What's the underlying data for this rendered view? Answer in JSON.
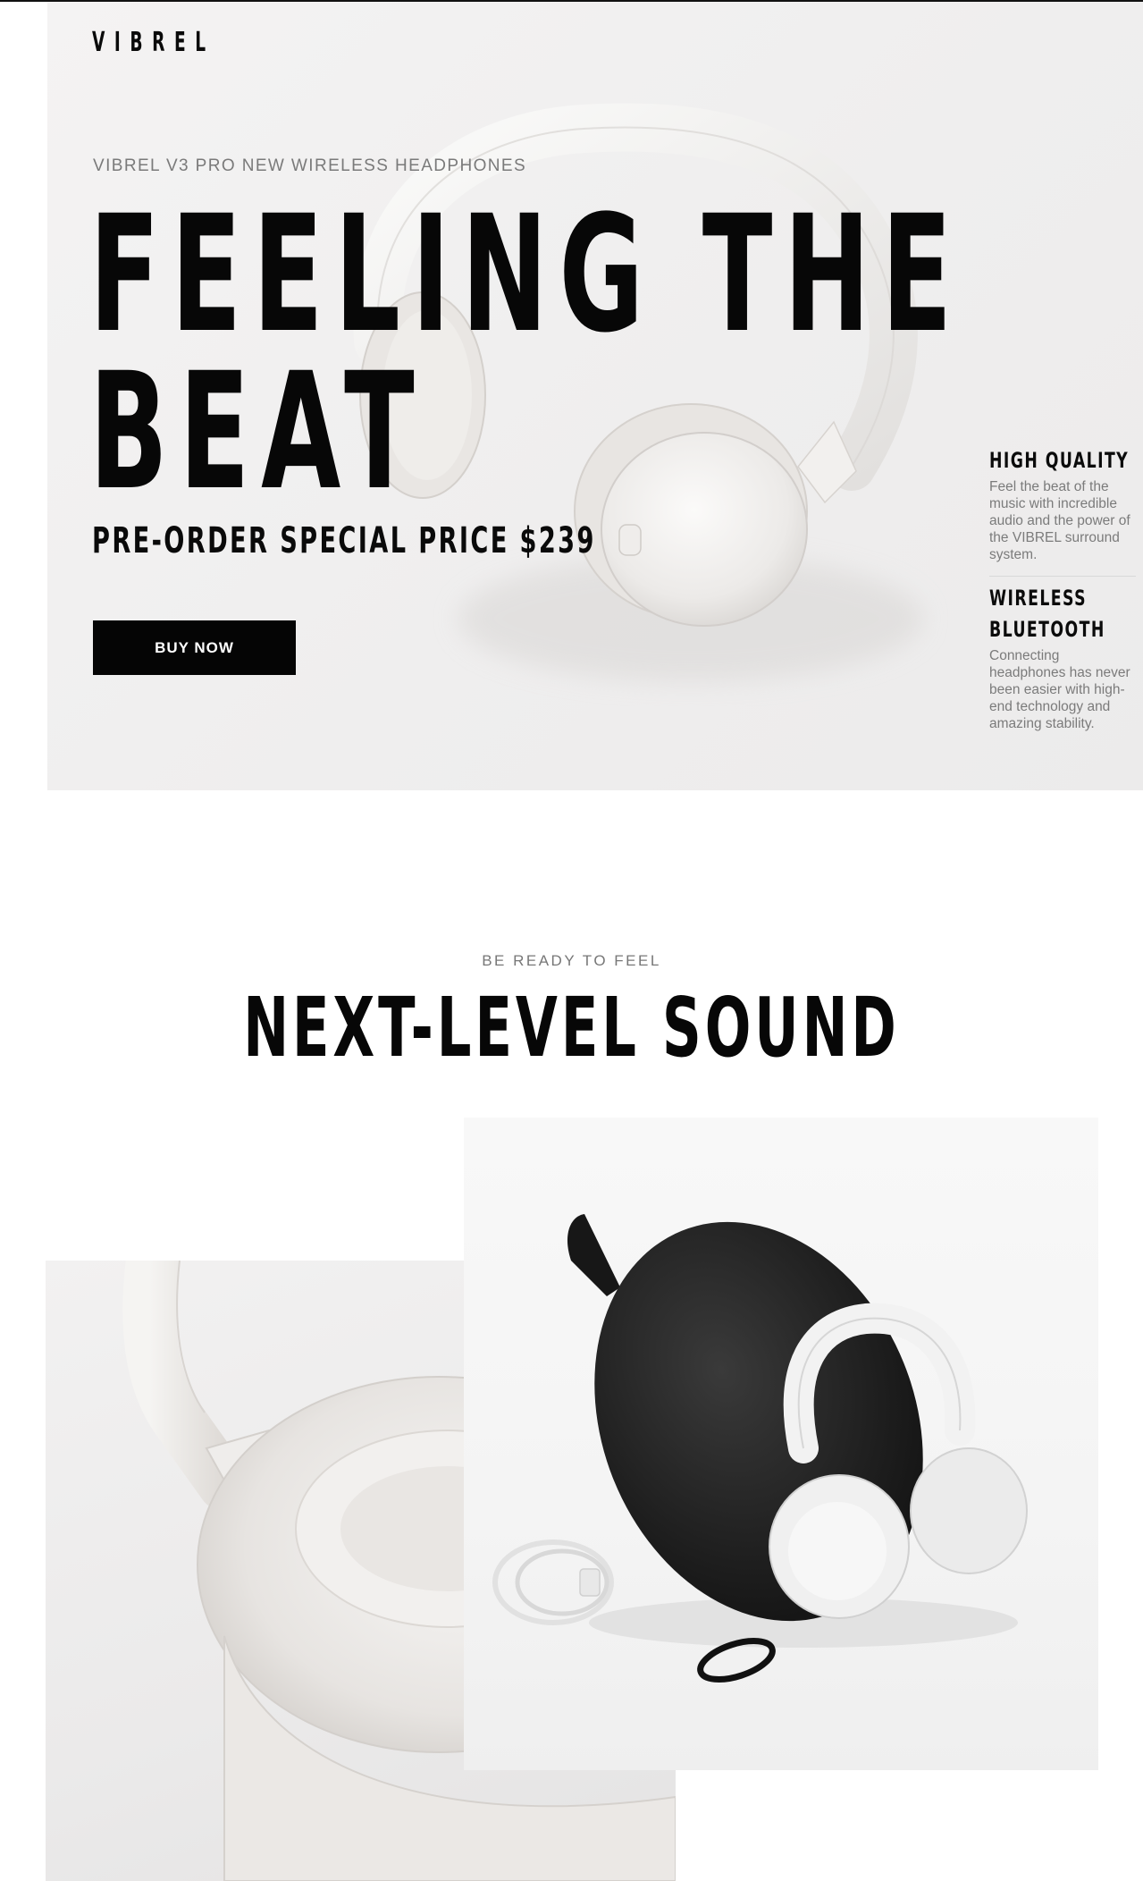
{
  "brand": {
    "logo": "VIBREL"
  },
  "hero": {
    "eyebrow": "VIBREL V3 PRO NEW WIRELESS HEADPHONES",
    "headline_line1": "FEELING THE",
    "headline_line2": "BEAT",
    "price": "PRE-ORDER SPECIAL PRICE $239",
    "buy_label": "BUY NOW"
  },
  "features": [
    {
      "title_lines": [
        "HIGH QUALITY"
      ],
      "text": "Feel the beat of the music with incredible audio and the power of the VIBREL surround system."
    },
    {
      "title_lines": [
        "WIRELESS",
        "BLUETOOTH"
      ],
      "text": "Connecting headphones has never been easier with high-end technology and amazing stability."
    }
  ],
  "section2": {
    "kicker": "BE READY TO FEEL",
    "title": "NEXT-LEVEL SOUND"
  },
  "images": {
    "hero": "white-headphones-photo",
    "left": "headphone-earcup-closeup-photo",
    "right": "headphones-with-case-and-accessories-photo"
  },
  "colors": {
    "primary": "#050505",
    "background": "#ffffff",
    "muted_text": "#7b7b7b"
  }
}
